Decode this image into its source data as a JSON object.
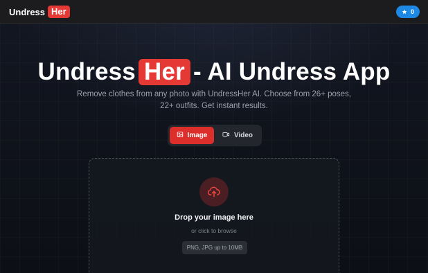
{
  "header": {
    "logo_word": "Undress",
    "logo_pill": "Her",
    "credits_count": "0",
    "credits_icon": "star-icon"
  },
  "hero": {
    "title_start": "Undress",
    "title_pill": "Her",
    "title_end": "- AI Undress App",
    "subtitle": "Remove clothes from any photo with UndressHer AI. Choose from 26+ poses, 22+ outfits. Get instant results."
  },
  "mode_toggle": {
    "image_label": "Image",
    "video_label": "Video",
    "selected": "Image"
  },
  "dropzone": {
    "title": "Drop your image here",
    "subtitle": "or click to browse",
    "formats": "PNG, JPG up to 10MB",
    "icon": "cloud-upload-icon"
  },
  "colors": {
    "brand_red": "#e53935",
    "credits_blue": "#1e88e5",
    "background": "#0d1016"
  }
}
